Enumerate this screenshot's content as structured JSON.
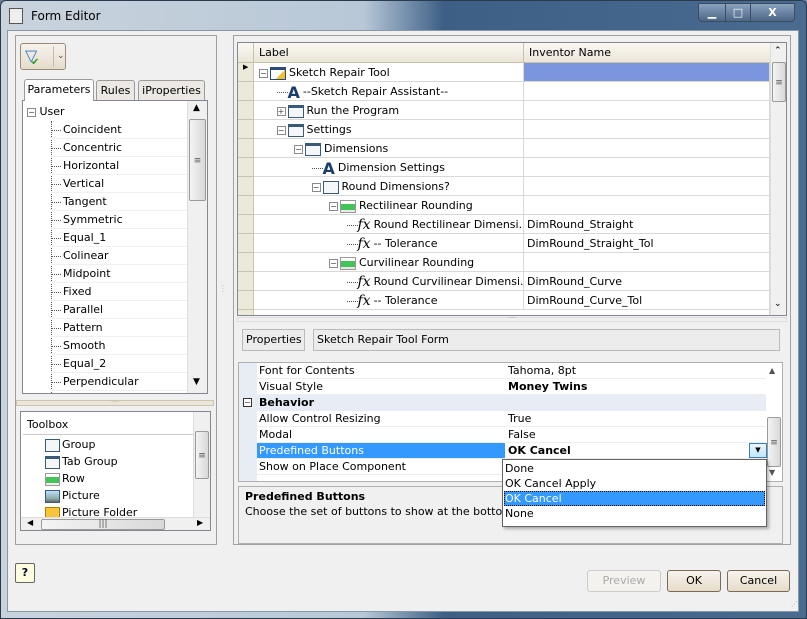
{
  "window": {
    "title": "Form Editor",
    "minimize": "▁",
    "maximize": "□",
    "close": "X"
  },
  "left": {
    "tabs": [
      "Parameters",
      "Rules",
      "iProperties"
    ],
    "tree_root": "User",
    "parameters": [
      "Coincident",
      "Concentric",
      "Horizontal",
      "Vertical",
      "Tangent",
      "Symmetric",
      "Equal_1",
      "Colinear",
      "Midpoint",
      "Fixed",
      "Parallel",
      "Pattern",
      "Smooth",
      "Equal_2",
      "Perpendicular"
    ],
    "toolbox": {
      "title": "Toolbox",
      "items": [
        {
          "label": "Group",
          "icon": "group-icon"
        },
        {
          "label": "Tab Group",
          "icon": "tab-group-icon"
        },
        {
          "label": "Row",
          "icon": "row-icon"
        },
        {
          "label": "Picture",
          "icon": "picture-icon"
        },
        {
          "label": "Picture Folder",
          "icon": "picture-folder-icon"
        }
      ]
    }
  },
  "grid": {
    "headers": [
      "Label",
      "Inventor Name"
    ],
    "rows": [
      {
        "label": "Sketch Repair Tool",
        "name": "",
        "icon": "form-icon",
        "level": 0,
        "expander": "-"
      },
      {
        "label": "--Sketch Repair Assistant--",
        "name": "",
        "icon": "label-icon",
        "level": 1,
        "expander": ""
      },
      {
        "label": "Run the Program",
        "name": "",
        "icon": "tab-group-icon",
        "level": 1,
        "expander": "+"
      },
      {
        "label": "Settings",
        "name": "",
        "icon": "tab-group-icon",
        "level": 1,
        "expander": "-"
      },
      {
        "label": "Dimensions",
        "name": "",
        "icon": "tab-group-icon",
        "level": 2,
        "expander": "-"
      },
      {
        "label": "Dimension Settings",
        "name": "",
        "icon": "label-icon",
        "level": 3,
        "expander": ""
      },
      {
        "label": "Round Dimensions?",
        "name": "",
        "icon": "group-icon",
        "level": 3,
        "expander": "-"
      },
      {
        "label": "Rectilinear Rounding",
        "name": "",
        "icon": "row-icon",
        "level": 4,
        "expander": "-"
      },
      {
        "label": "Round Rectilinear Dimensi...",
        "name": "DimRound_Straight",
        "icon": "parameter-icon",
        "level": 5,
        "expander": ""
      },
      {
        "label": "-- Tolerance",
        "name": "DimRound_Straight_Tol",
        "icon": "parameter-icon",
        "level": 5,
        "expander": ""
      },
      {
        "label": "Curvilinear Rounding",
        "name": "",
        "icon": "row-icon",
        "level": 4,
        "expander": "-"
      },
      {
        "label": "Round Curvilinear Dimensi...",
        "name": "DimRound_Curve",
        "icon": "parameter-icon",
        "level": 5,
        "expander": ""
      },
      {
        "label": "-- Tolerance",
        "name": "DimRound_Curve_Tol",
        "icon": "parameter-icon",
        "level": 5,
        "expander": ""
      }
    ]
  },
  "properties": {
    "tab": "Properties",
    "object": "Sketch Repair Tool Form",
    "rows": [
      {
        "name": "Font for Contents",
        "value": "Tahoma, 8pt"
      },
      {
        "name": "Visual Style",
        "value": "Money Twins",
        "bold": true
      },
      {
        "category": "Behavior"
      },
      {
        "name": "Allow Control Resizing",
        "value": "True"
      },
      {
        "name": "Modal",
        "value": "False"
      },
      {
        "name": "Predefined Buttons",
        "value": "OK Cancel",
        "bold": true,
        "selected": true
      },
      {
        "name": "Show on Place Component",
        "value": ""
      }
    ],
    "dropdown_options": [
      "Done",
      "OK Cancel Apply",
      "OK Cancel",
      "None"
    ],
    "dropdown_selected": "OK Cancel",
    "description_title": "Predefined Buttons",
    "description_text": "Choose the set of buttons to show at the bottom of t"
  },
  "footer": {
    "preview": "Preview",
    "ok": "OK",
    "cancel": "Cancel",
    "help": "?"
  },
  "colors": {
    "selection": "#3399ff",
    "grid_selection": "#7b96dc",
    "title_bar": "#3d5f86"
  }
}
